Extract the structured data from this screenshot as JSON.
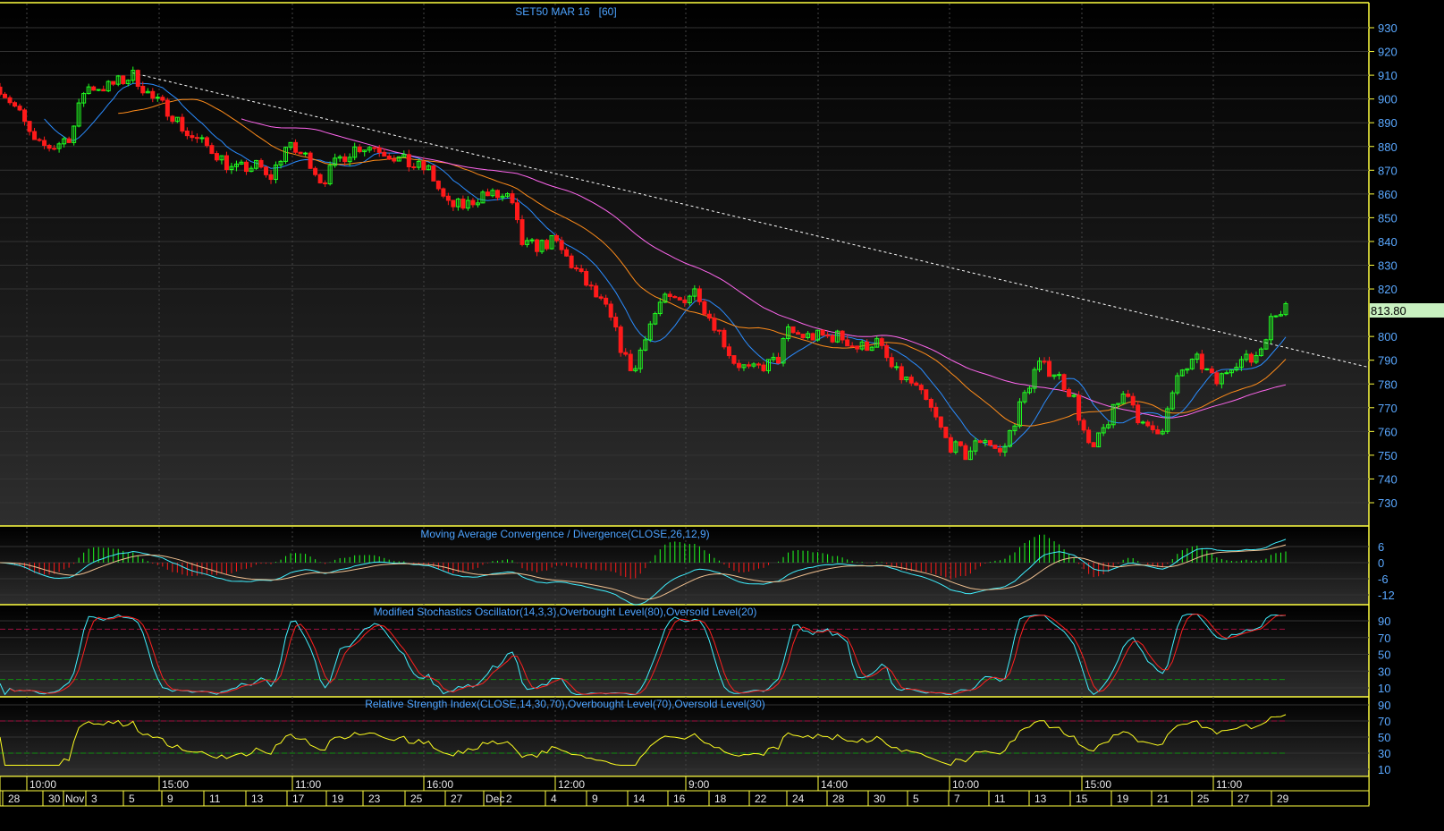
{
  "chart_data": {
    "type": "candlestick",
    "title": "SET50 MAR 16",
    "interval": "[60]",
    "last_price": "813.80",
    "ylim": [
      725,
      937
    ],
    "yticks": [
      930,
      920,
      910,
      900,
      890,
      880,
      870,
      860,
      850,
      840,
      830,
      820,
      800,
      790,
      780,
      770,
      760,
      750,
      740,
      730
    ],
    "close_path": [
      [
        0,
        905
      ],
      [
        20,
        895
      ],
      [
        40,
        880
      ],
      [
        60,
        880
      ],
      [
        80,
        885
      ],
      [
        95,
        905
      ],
      [
        120,
        905
      ],
      [
        150,
        910
      ],
      [
        170,
        900
      ],
      [
        190,
        895
      ],
      [
        210,
        885
      ],
      [
        240,
        878
      ],
      [
        260,
        870
      ],
      [
        290,
        872
      ],
      [
        300,
        865
      ],
      [
        320,
        880
      ],
      [
        345,
        875
      ],
      [
        360,
        865
      ],
      [
        380,
        875
      ],
      [
        400,
        880
      ],
      [
        420,
        880
      ],
      [
        440,
        876
      ],
      [
        460,
        872
      ],
      [
        480,
        870
      ],
      [
        500,
        855
      ],
      [
        520,
        855
      ],
      [
        540,
        860
      ],
      [
        570,
        858
      ],
      [
        585,
        838
      ],
      [
        600,
        838
      ],
      [
        620,
        840
      ],
      [
        640,
        830
      ],
      [
        660,
        820
      ],
      [
        680,
        810
      ],
      [
        700,
        790
      ],
      [
        710,
        785
      ],
      [
        720,
        800
      ],
      [
        740,
        815
      ],
      [
        760,
        815
      ],
      [
        780,
        820
      ],
      [
        790,
        810
      ],
      [
        800,
        805
      ],
      [
        820,
        790
      ],
      [
        840,
        785
      ],
      [
        850,
        787
      ],
      [
        870,
        790
      ],
      [
        880,
        802
      ],
      [
        900,
        800
      ],
      [
        920,
        800
      ],
      [
        940,
        800
      ],
      [
        960,
        795
      ],
      [
        980,
        798
      ],
      [
        1000,
        785
      ],
      [
        1020,
        780
      ],
      [
        1040,
        770
      ],
      [
        1060,
        755
      ],
      [
        1080,
        750
      ],
      [
        1100,
        758
      ],
      [
        1120,
        750
      ],
      [
        1140,
        770
      ],
      [
        1160,
        788
      ],
      [
        1180,
        785
      ],
      [
        1200,
        775
      ],
      [
        1220,
        750
      ],
      [
        1240,
        765
      ],
      [
        1260,
        778
      ],
      [
        1280,
        760
      ],
      [
        1300,
        762
      ],
      [
        1320,
        785
      ],
      [
        1340,
        790
      ],
      [
        1360,
        780
      ],
      [
        1380,
        790
      ],
      [
        1400,
        790
      ],
      [
        1410,
        795
      ],
      [
        1420,
        806
      ],
      [
        1438,
        813.8
      ]
    ],
    "moving_averages": [
      {
        "name": "short",
        "color": "#2a8cff"
      },
      {
        "name": "medium",
        "color": "#ff8c1a"
      },
      {
        "name": "long",
        "color": "#ff66ee"
      }
    ],
    "trendline": {
      "from": 911,
      "to": 787,
      "color": "#ffffff"
    },
    "indicators": [
      {
        "name": "macd",
        "title": "Moving Average Convergence / Divergence(CLOSE,26,12,9)",
        "yticks": [
          "6",
          "0",
          "-6",
          "-12"
        ]
      },
      {
        "name": "stoch",
        "title": "Modified Stochastics Oscillator(14,3,3),Overbought Level(80),Oversold Level(20)",
        "yticks": [
          "90",
          "70",
          "50",
          "30",
          "10"
        ]
      },
      {
        "name": "rsi",
        "title": "Relative Strength Index(CLOSE,14,30,70),Overbought Level(70),Oversold Level(30)",
        "yticks": [
          "90",
          "70",
          "50",
          "30",
          "10"
        ]
      }
    ],
    "time_labels": [
      "10:00",
      "15:00",
      "11:00",
      "16:00",
      "12:00",
      "9:00",
      "14:00",
      "10:00",
      "15:00",
      "11:00"
    ],
    "date_labels": [
      "28",
      "30",
      "Nov",
      "3",
      "5",
      "9",
      "11",
      "13",
      "17",
      "19",
      "23",
      "25",
      "27",
      "Dec",
      "2",
      "4",
      "9",
      "14",
      "16",
      "18",
      "22",
      "24",
      "28",
      "30",
      "5",
      "7",
      "11",
      "13",
      "15",
      "19",
      "21",
      "25",
      "27",
      "29"
    ]
  }
}
